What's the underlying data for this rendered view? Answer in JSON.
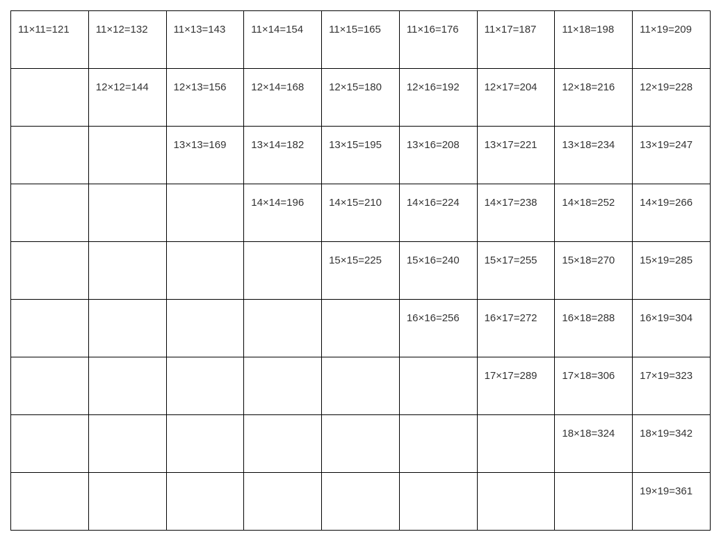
{
  "table": {
    "rows": [
      [
        "11×11=121",
        "11×12=132",
        "11×13=143",
        "11×14=154",
        "11×15=165",
        "11×16=176",
        "11×17=187",
        "11×18=198",
        "11×19=209"
      ],
      [
        "",
        "12×12=144",
        "12×13=156",
        "12×14=168",
        "12×15=180",
        "12×16=192",
        "12×17=204",
        "12×18=216",
        "12×19=228"
      ],
      [
        "",
        "",
        "13×13=169",
        "13×14=182",
        "13×15=195",
        "13×16=208",
        "13×17=221",
        "13×18=234",
        "13×19=247"
      ],
      [
        "",
        "",
        "",
        "14×14=196",
        "14×15=210",
        "14×16=224",
        "14×17=238",
        "14×18=252",
        "14×19=266"
      ],
      [
        "",
        "",
        "",
        "",
        "15×15=225",
        "15×16=240",
        "15×17=255",
        "15×18=270",
        "15×19=285"
      ],
      [
        "",
        "",
        "",
        "",
        "",
        "16×16=256",
        "16×17=272",
        "16×18=288",
        "16×19=304"
      ],
      [
        "",
        "",
        "",
        "",
        "",
        "",
        "17×17=289",
        "17×18=306",
        "17×19=323"
      ],
      [
        "",
        "",
        "",
        "",
        "",
        "",
        "",
        "18×18=324",
        "18×19=342"
      ],
      [
        "",
        "",
        "",
        "",
        "",
        "",
        "",
        "",
        "19×19=361"
      ]
    ]
  }
}
